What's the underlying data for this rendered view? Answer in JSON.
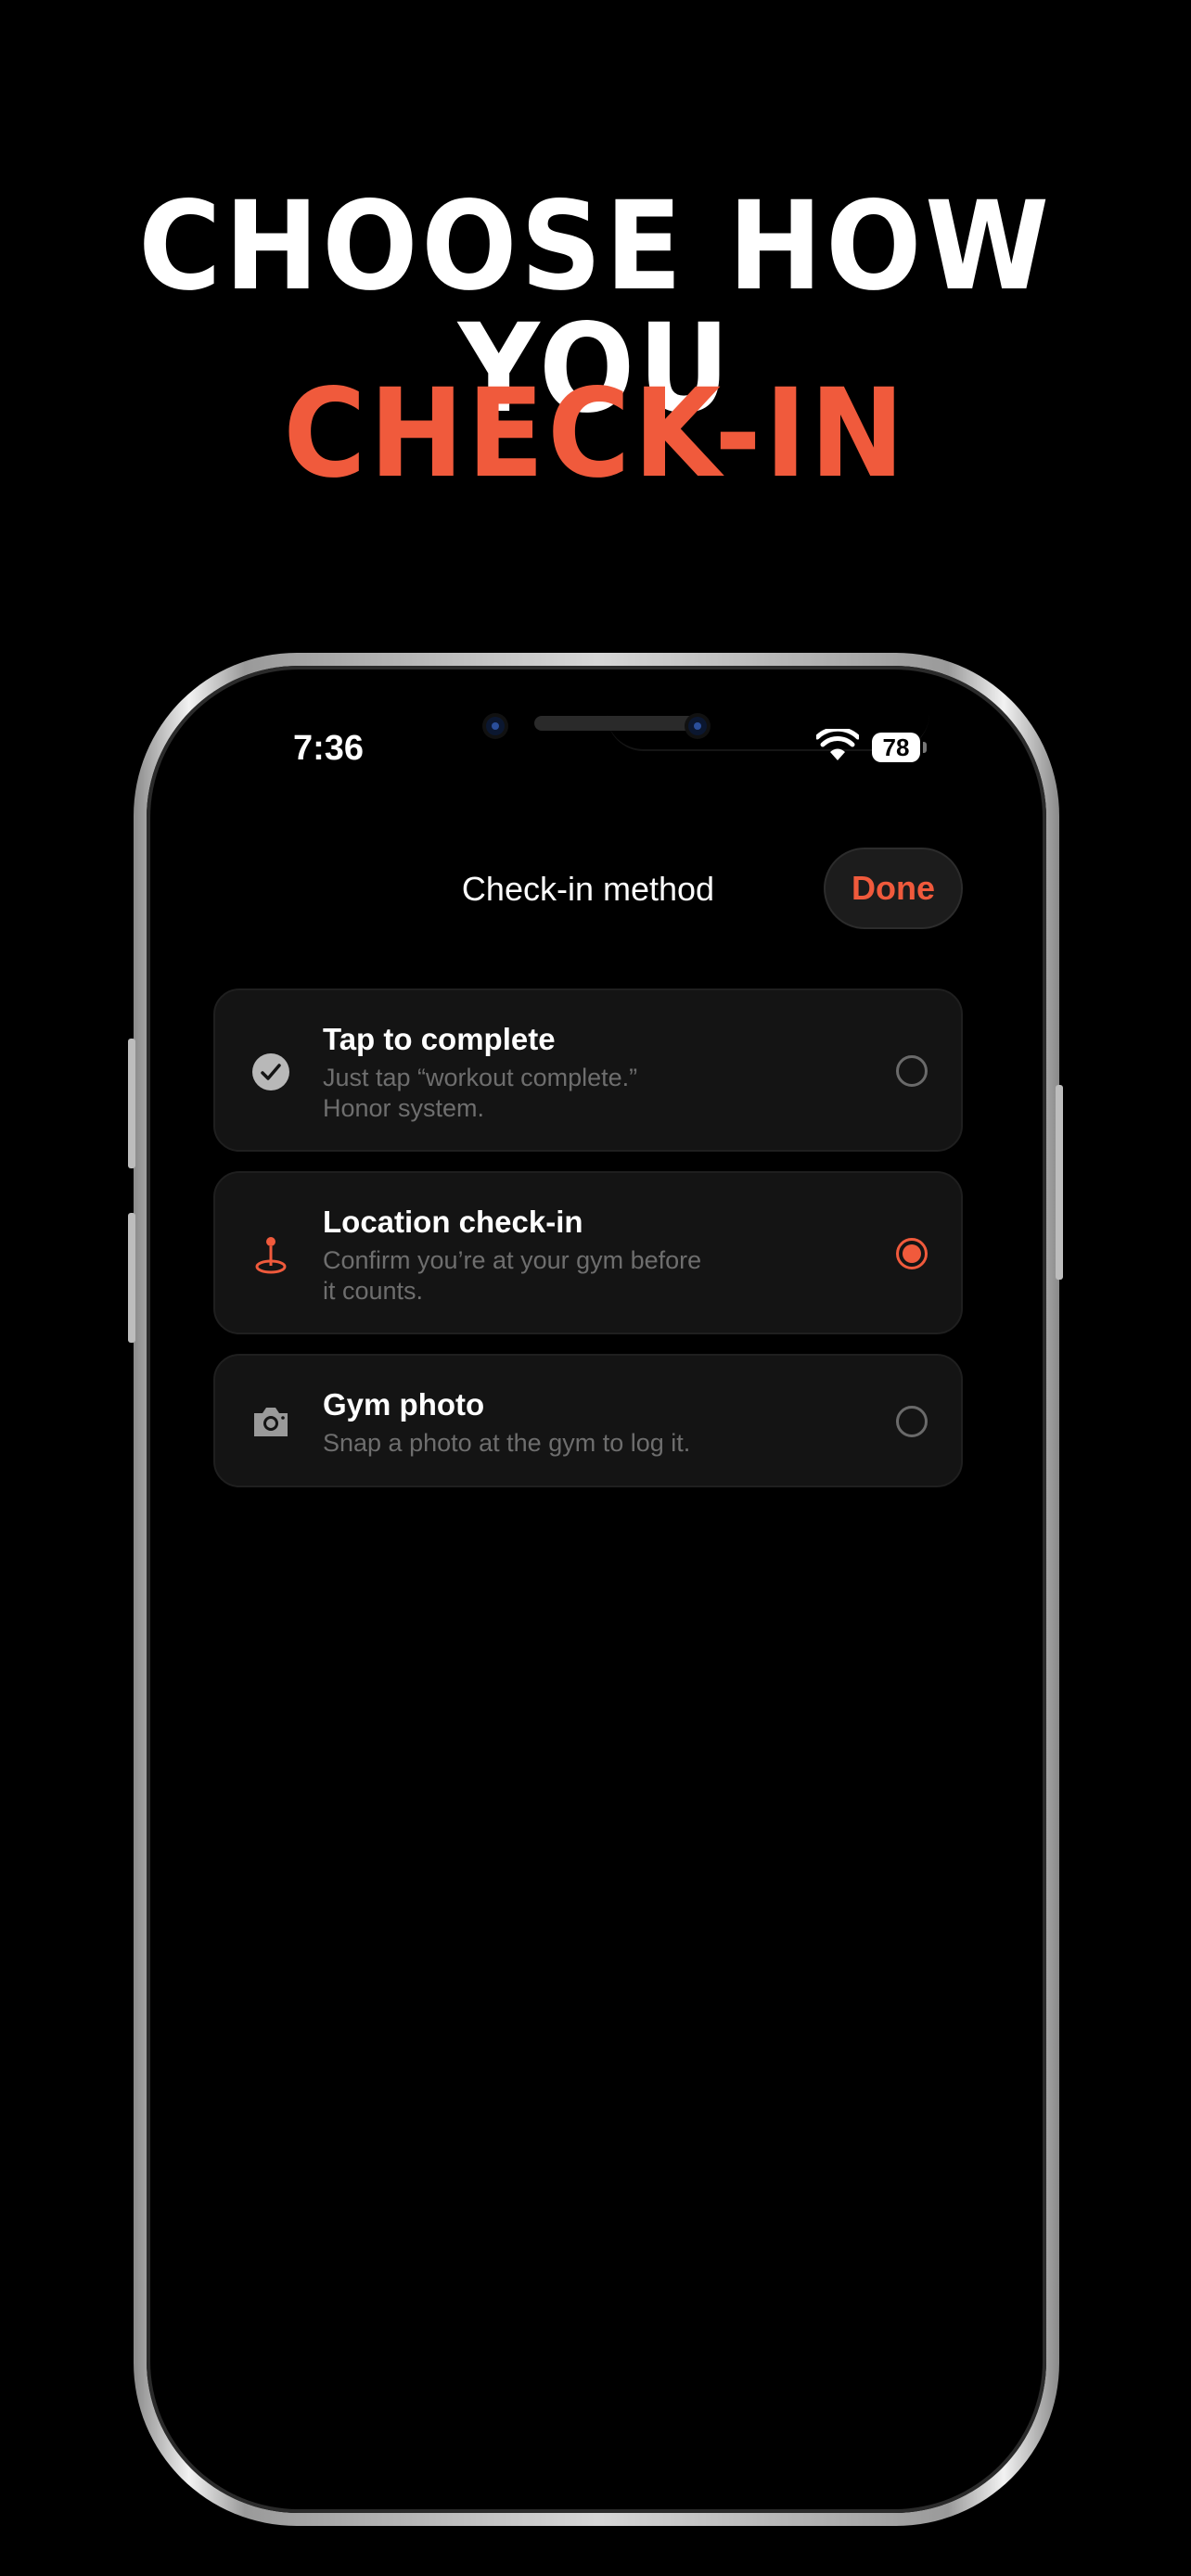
{
  "colors": {
    "accent": "#f05a3c",
    "background": "#000000",
    "card": "#141414"
  },
  "headline": {
    "line1": "CHOOSE HOW YOU",
    "line2": "CHECK-IN"
  },
  "status_bar": {
    "time": "7:36",
    "battery": "78"
  },
  "nav": {
    "title": "Check-in method",
    "done_label": "Done"
  },
  "options": [
    {
      "icon": "checkmark-circle-icon",
      "title": "Tap to complete",
      "desc_line1": "Just tap “workout complete.”",
      "desc_line2": "Honor system.",
      "selected": false
    },
    {
      "icon": "location-pin-icon",
      "title": "Location check-in",
      "desc_line1": "Confirm you’re at your gym before",
      "desc_line2": "it counts.",
      "selected": true
    },
    {
      "icon": "camera-icon",
      "title": "Gym photo",
      "desc_line1": "Snap a photo at the gym to log it.",
      "desc_line2": "",
      "selected": false
    }
  ]
}
